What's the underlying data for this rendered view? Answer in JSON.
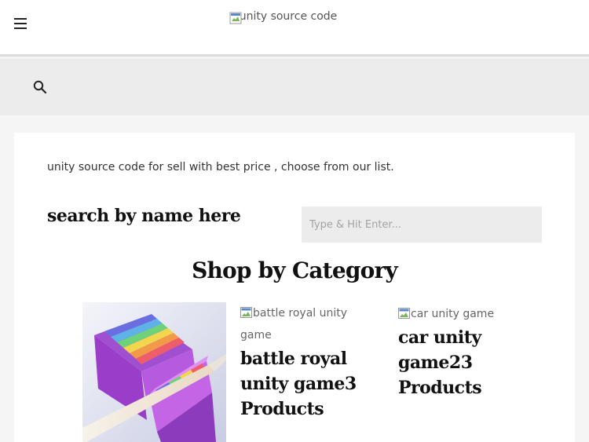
{
  "header": {
    "menu_icon": "hamburger-menu-icon",
    "logo_alt": "unity source code"
  },
  "search_bar": {
    "icon": "search-icon"
  },
  "main": {
    "intro_text": "unity source code for sell with best price , choose from our list.",
    "search_heading": "search by name here",
    "search_placeholder": "Type & Hit Enter...",
    "section_title": "Shop by Category"
  },
  "categories": [
    {
      "image": "rainbow-cube-slice-image"
    },
    {
      "image_alt": "battle royal unity game",
      "name": "battle royal unity game3 Products"
    },
    {
      "image_alt": "car unity game",
      "name": "car unity game23 Products"
    }
  ],
  "colors": {
    "header_bg": "#ffffff",
    "searchbar_bg": "#ececec",
    "page_bg": "#f5f5f5",
    "heading_text": "#111111",
    "input_bg": "#ececec"
  }
}
